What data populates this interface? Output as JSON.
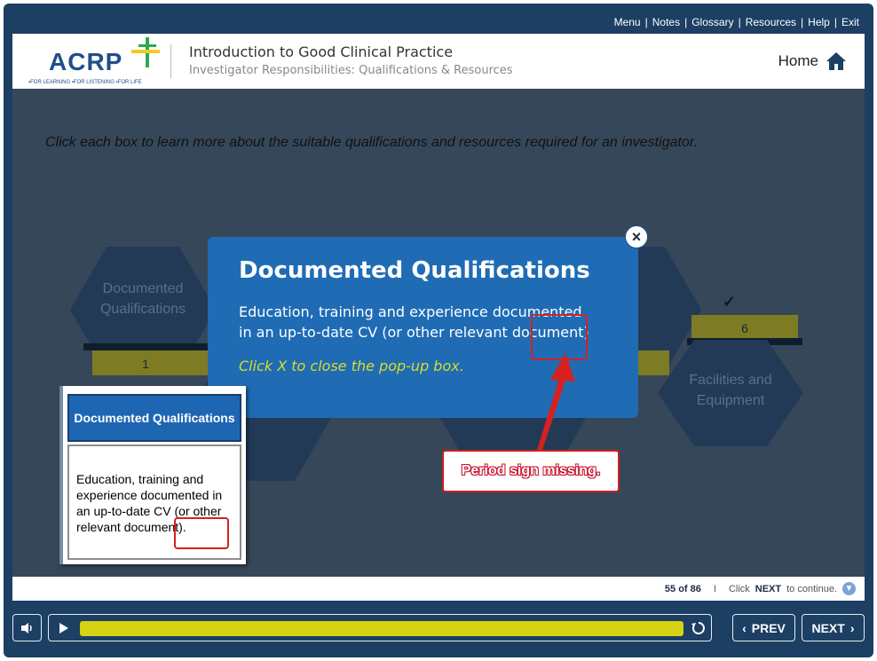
{
  "topnav": {
    "items": [
      "Menu",
      "Notes",
      "Glossary",
      "Resources",
      "Help",
      "Exit"
    ]
  },
  "header": {
    "logo_text": "ACRP",
    "logo_tagline": "▪FOR LEARNING ▪FOR LISTENING ▪FOR LIFE",
    "course_title": "Introduction to Good Clinical Practice",
    "course_subtitle": "Investigator Responsibilities: Qualifications & Resources",
    "home_label": "Home"
  },
  "stage": {
    "instruction": "Click each box to learn more about the suitable qualifications and resources required for an investigator.",
    "hexes": [
      {
        "label_line1": "Documented",
        "label_line2": "Qualifications",
        "number": "1"
      },
      {
        "label_line1": "Facilities and",
        "label_line2": "Equipment",
        "number": "6",
        "completed_mark": "✓"
      }
    ]
  },
  "popup": {
    "title": "Documented Qualifications",
    "body": "Education, training and experience documented in an up-to-date CV (or other relevant document)",
    "hint": "Click X to close the pop-up box.",
    "close_label": "×"
  },
  "annotation": {
    "callout_text": "Period sign missing.",
    "accent_color": "#d62121"
  },
  "reference": {
    "title": "Documented Qualifications",
    "body": "Education, training and experience documented in an up-to-date CV (or other relevant document)."
  },
  "footer": {
    "page_position": "55 of 86",
    "separator": "I",
    "continue_prefix": "Click",
    "continue_bold": "NEXT",
    "continue_suffix": "to continue."
  },
  "controls": {
    "prev_label": "PREV",
    "next_label": "NEXT",
    "progress_fraction": 1.0,
    "icons": [
      "volume-icon",
      "play-icon",
      "replay-icon"
    ]
  },
  "colors": {
    "frame": "#1c3f63",
    "popup": "#1f6cb5",
    "progress": "#d7d213",
    "hint": "#d7dc2a"
  }
}
